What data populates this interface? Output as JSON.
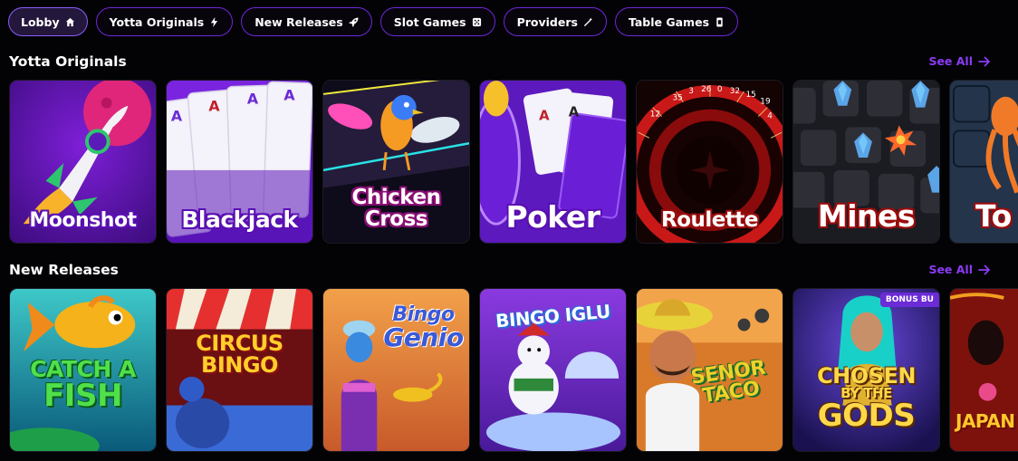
{
  "tabs": [
    {
      "label": "Lobby",
      "icon": "home-icon",
      "active": true
    },
    {
      "label": "Yotta Originals",
      "icon": "lightning-icon",
      "active": false
    },
    {
      "label": "New Releases",
      "icon": "rocket-icon",
      "active": false
    },
    {
      "label": "Slot Games",
      "icon": "dice-icon",
      "active": false
    },
    {
      "label": "Providers",
      "icon": "wand-icon",
      "active": false
    },
    {
      "label": "Table Games",
      "icon": "card-icon",
      "active": false
    }
  ],
  "originals": {
    "title": "Yotta Originals",
    "see_all": "See All",
    "games": [
      {
        "name": "Moonshot"
      },
      {
        "name": "Blackjack"
      },
      {
        "name_line1": "Chicken",
        "name_line2": "Cross"
      },
      {
        "name": "Poker"
      },
      {
        "name": "Roulette"
      },
      {
        "name": "Mines"
      },
      {
        "name": "To"
      }
    ]
  },
  "releases": {
    "title": "New Releases",
    "see_all": "See All",
    "games": [
      {
        "line1": "CATCH A",
        "line2": "FISH"
      },
      {
        "line1": "CIRCUS",
        "line2": "BINGO"
      },
      {
        "line1": "Bingo",
        "line2": "Genio"
      },
      {
        "line1": "BINGO IGLU"
      },
      {
        "line1": "SENOR",
        "line2": "TACO"
      },
      {
        "line1": "CHOSEN",
        "line2": "BY THE",
        "line3": "GODS",
        "badge": "BONUS BU"
      },
      {
        "line1": "JAPAN"
      }
    ]
  },
  "colors": {
    "accent": "#8b3bf5",
    "tab_border": "#6d28d9",
    "background": "#030205"
  }
}
